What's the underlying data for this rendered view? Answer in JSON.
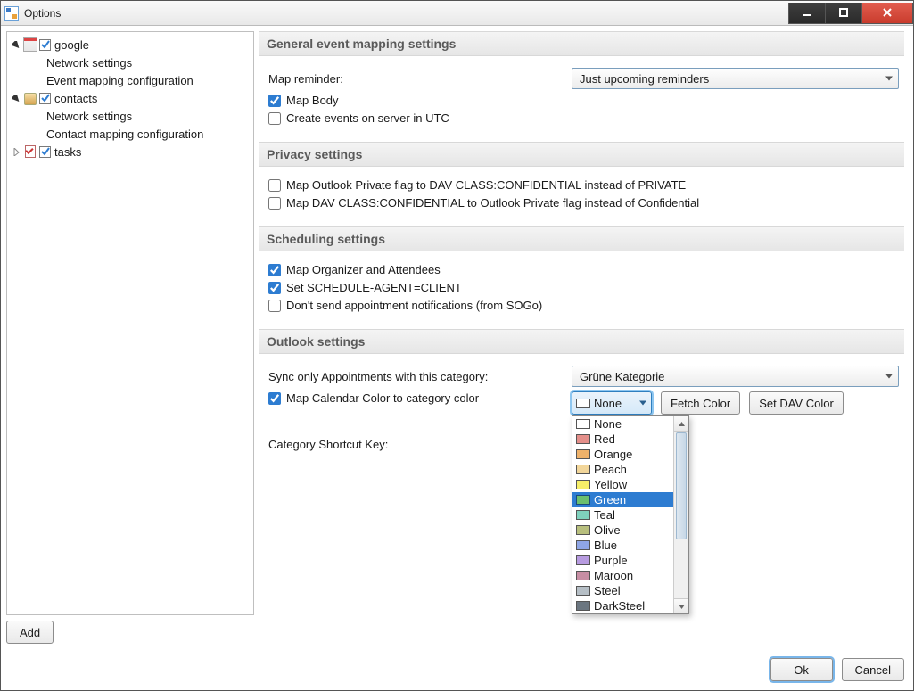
{
  "window": {
    "title": "Options"
  },
  "tree": {
    "google": {
      "label": "google",
      "net": "Network settings",
      "evt": "Event mapping configuration"
    },
    "contacts": {
      "label": "contacts",
      "net": "Network settings",
      "cmp": "Contact mapping configuration"
    },
    "tasks": {
      "label": "tasks"
    }
  },
  "add_label": "Add",
  "general": {
    "header": "General event mapping settings",
    "map_reminder_label": "Map reminder:",
    "map_reminder_value": "Just upcoming reminders",
    "map_body_label": "Map Body",
    "utc_label": "Create events on server in UTC"
  },
  "privacy": {
    "header": "Privacy settings",
    "opt1": "Map Outlook Private flag to DAV CLASS:CONFIDENTIAL instead of PRIVATE",
    "opt2": "Map DAV CLASS:CONFIDENTIAL to Outlook Private flag instead of Confidential"
  },
  "scheduling": {
    "header": "Scheduling settings",
    "opt1": "Map Organizer and Attendees",
    "opt2": "Set SCHEDULE-AGENT=CLIENT",
    "opt3": "Don't send appointment notifications (from SOGo)"
  },
  "outlook": {
    "header": "Outlook settings",
    "sync_label": "Sync only Appointments with this category:",
    "sync_value": "Grüne Kategorie",
    "map_color_label": "Map Calendar Color to category color",
    "color_selected": "None",
    "fetch_label": "Fetch Color",
    "setdav_label": "Set DAV Color",
    "shortcut_label": "Category Shortcut Key:"
  },
  "colors": [
    {
      "name": "None",
      "hex": "#ffffff"
    },
    {
      "name": "Red",
      "hex": "#e48f8a"
    },
    {
      "name": "Orange",
      "hex": "#efb26a"
    },
    {
      "name": "Peach",
      "hex": "#f2d69a"
    },
    {
      "name": "Yellow",
      "hex": "#f7ef69"
    },
    {
      "name": "Green",
      "hex": "#6bbf6e"
    },
    {
      "name": "Teal",
      "hex": "#7fd1bd"
    },
    {
      "name": "Olive",
      "hex": "#b8bf7e"
    },
    {
      "name": "Blue",
      "hex": "#8fa6e6"
    },
    {
      "name": "Purple",
      "hex": "#b79be0"
    },
    {
      "name": "Maroon",
      "hex": "#c78ea4"
    },
    {
      "name": "Steel",
      "hex": "#b6bfc6"
    },
    {
      "name": "DarkSteel",
      "hex": "#6b7680"
    }
  ],
  "color_selected_index": 5,
  "footer": {
    "ok": "Ok",
    "cancel": "Cancel"
  }
}
